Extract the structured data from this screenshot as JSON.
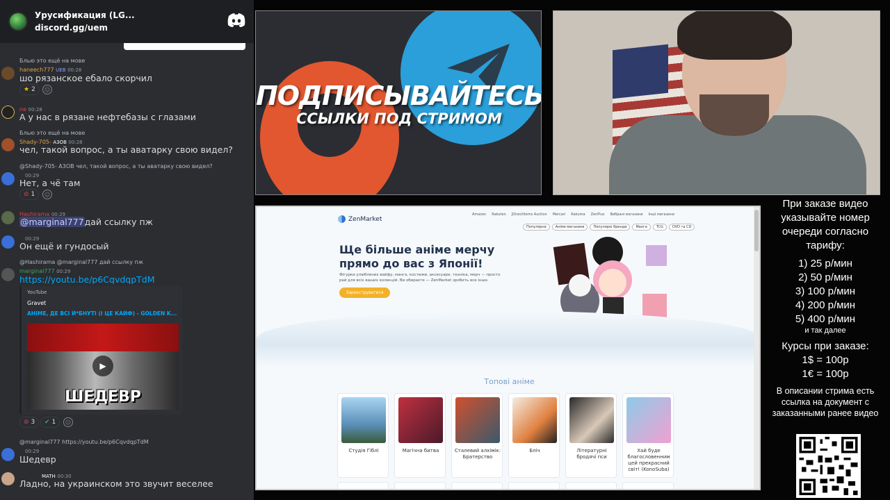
{
  "discord": {
    "server_name": "Урусификация (LG...",
    "server_link": "discord.gg/uem",
    "messages": [
      {
        "reply": "Блью это ещё на мове",
        "user": "haneech777",
        "user_color": "#e5a443",
        "tag": "UEB",
        "time": "00:28",
        "text": "шо рязанское ебало скорчил",
        "reaction_count": "2"
      },
      {
        "user": "ne",
        "user_color": "#e04545",
        "time": "00:28",
        "text": "А у нас в рязане нефтебазы с глазами"
      },
      {
        "reply": "Блью это ещё на мове",
        "user": "Shady-705-",
        "user_color": "#e5a443",
        "tag": "А3ОВ",
        "time": "00:28",
        "text": "чел, такой вопрос, а ты аватарку свою видел?"
      },
      {
        "reply": "@Shady-705- А3ОВ чел, такой вопрос, а ты аватарку свою видел?",
        "time": "00:29",
        "text": "Нет, а чё там",
        "reaction_count": "1"
      },
      {
        "user": "Hashirama",
        "user_color": "#e04545",
        "time": "00:29",
        "mention": "@marginal777",
        "text": "дай ссылку пж"
      },
      {
        "time": "00:29",
        "text": "Он ещё и гундосый"
      },
      {
        "reply": "@Hashirama @marginal777 дай ссылку пж",
        "user": "marginal777",
        "user_color": "#3ba55d",
        "time": "00:29",
        "link": "https://youtu.be/p6CqvdqpTdM"
      },
      {
        "reply": "@marginal777 https://youtu.be/p6CqvdqpTdM",
        "time": "00:29",
        "text": "Шедевр"
      },
      {
        "tag": "MATH",
        "time": "00:30",
        "text": "Ладно, на украинском это звучит веселее"
      }
    ],
    "embed": {
      "provider": "YouTube",
      "author": "Gravet",
      "title": "АНІМЕ, ДЕ ВСІ Й*БНУТІ (І ЦЕ КАЙФ) - GOLDEN K...",
      "thumb_caption": "ШЕДЕВР"
    },
    "embed_reactions": [
      "3",
      "1"
    ]
  },
  "promo": {
    "title": "ПОДПИСЫВАЙТЕСЬ",
    "subtitle": "ССЫЛКИ ПОД СТРИМОМ"
  },
  "site": {
    "logo": "ZenMarket",
    "nav": [
      "Amazon",
      "Rakuten",
      "JDirectItems Auction",
      "Mercari",
      "Rakuma",
      "ZenPlus",
      "Вибрані магазини",
      "Інші магазини"
    ],
    "cats": [
      "Популярне",
      "Аніме-магазини",
      "Популярні бренди",
      "Манга",
      "TCG",
      "DVD та CD"
    ],
    "hero": "Ще більше аніме мерчу прямо до вас з Японії!",
    "desc": "Фігурки улюблених вайфу, манга, костюми, аксесуари, техніка, мерч — просто рай для всіх ваших колекцій. Ви обираєте — ZenMarket зробить все інше.",
    "cta": "Зареєструватися",
    "section": "Топові аніме",
    "cards": [
      {
        "title": "Студія Гіблі",
        "color": "#7bb3d8"
      },
      {
        "title": "Магічна битва",
        "color": "#7a2a3a"
      },
      {
        "title": "Сталевий алхімік: Братерство",
        "color": "#9a3a2a"
      },
      {
        "title": "Бліч",
        "color": "#e8e2d8"
      },
      {
        "title": "Літературні бродячі пси",
        "color": "#2a2a2a"
      },
      {
        "title": "Хай буде благословенним цей прекрасний світ! (KonoSuba)",
        "color": "#8ecbe8"
      }
    ]
  },
  "info": {
    "intro": "При заказе видео указывайте номер очереди согласно тарифу:",
    "tiers": [
      "1) 25 р/мин",
      "2) 50 р/мин",
      "3) 100 р/мин",
      "4) 200 р/мин",
      "5) 400 р/мин"
    ],
    "etc": "и так далее",
    "rates_title": "Курсы при заказе:",
    "rates": [
      "1$ = 100р",
      "1€ = 100р"
    ],
    "doc_note": "В описании стрима есть ссылка на документ с заказанными ранее видео"
  }
}
